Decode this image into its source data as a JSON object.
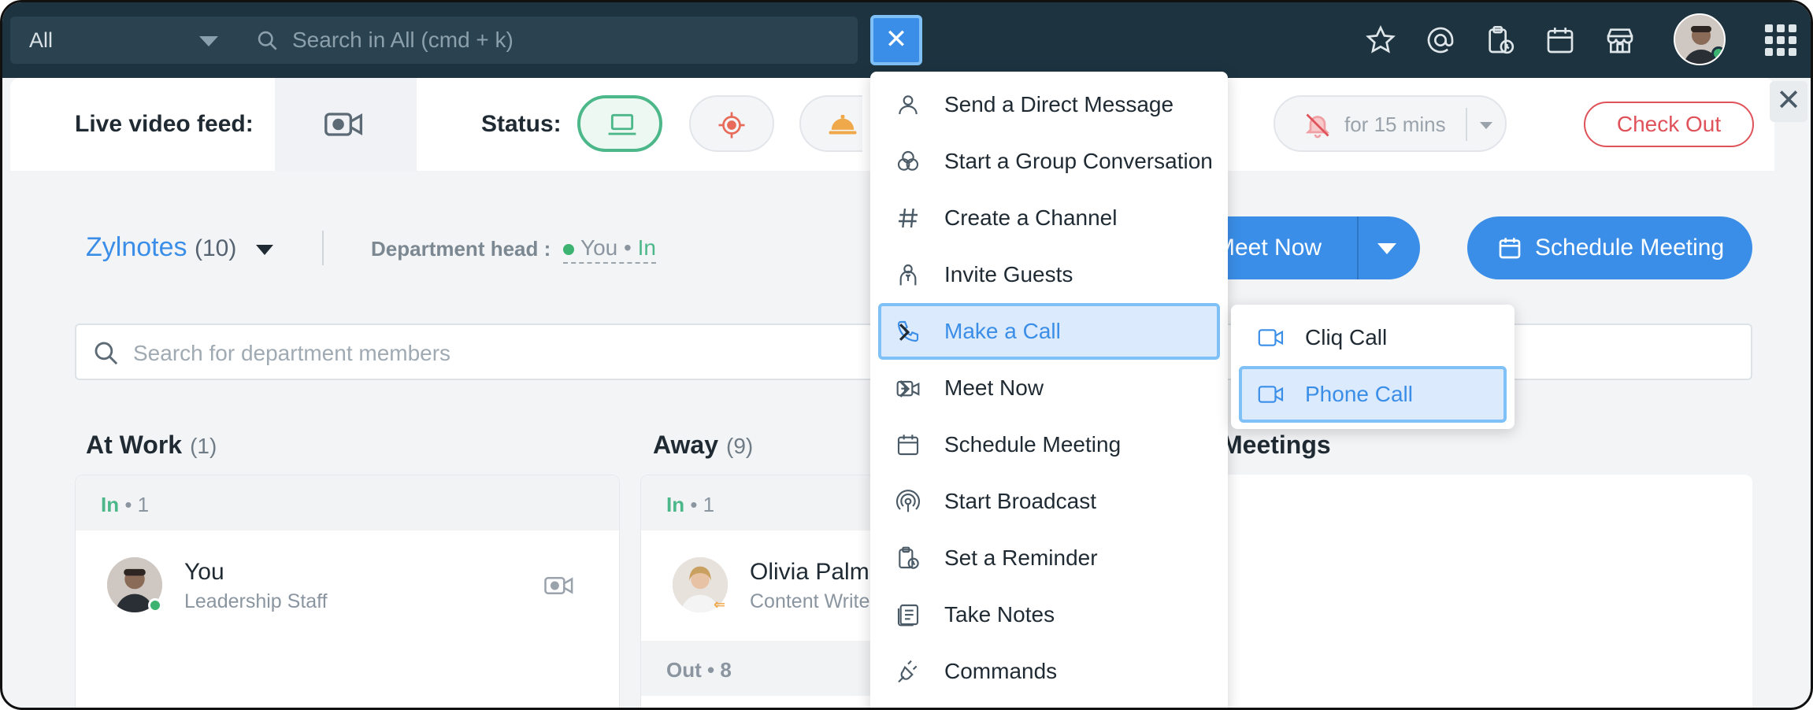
{
  "topbar": {
    "scope_label": "All",
    "search_placeholder": "Search in All (cmd + k)",
    "close_label": "✕"
  },
  "statusbar": {
    "live_video_label": "Live video feed:",
    "status_label": "Status:",
    "dnd_label": "for 15 mins",
    "checkout_label": "Check Out",
    "close_label": "✕"
  },
  "department": {
    "name": "Zylnotes",
    "count": "(10)",
    "head_label": "Department head :",
    "head_value": "You",
    "head_sep": " • ",
    "head_status": "In"
  },
  "actions": {
    "meet_now": "Meet Now",
    "schedule_meeting": "Schedule Meeting"
  },
  "member_search_placeholder": "Search for department members",
  "columns": {
    "at_work": {
      "title": "At Work",
      "count": "(1)",
      "sub_status": "In",
      "sub_count": " • 1",
      "member": {
        "name": "You",
        "role": "Leadership Staff"
      }
    },
    "away": {
      "title": "Away",
      "count": "(9)",
      "sub_status": "In",
      "sub_count": " • 1",
      "member": {
        "name": "Olivia Palme",
        "role": "Content Write"
      },
      "out_label": "Out • 8"
    },
    "meetings": {
      "title": "Meetings"
    }
  },
  "menu": {
    "items": [
      {
        "label": "Send a Direct Message",
        "icon": "person-icon"
      },
      {
        "label": "Start a Group Conversation",
        "icon": "group-icon"
      },
      {
        "label": "Create a Channel",
        "icon": "hash-icon"
      },
      {
        "label": "Invite Guests",
        "icon": "guest-icon"
      },
      {
        "label": "Make a Call",
        "icon": "phone-icon"
      },
      {
        "label": "Meet Now",
        "icon": "video-plus-icon"
      },
      {
        "label": "Schedule Meeting",
        "icon": "calendar-icon"
      },
      {
        "label": "Start Broadcast",
        "icon": "broadcast-icon"
      },
      {
        "label": "Set a Reminder",
        "icon": "reminder-icon"
      },
      {
        "label": "Take Notes",
        "icon": "notes-icon"
      },
      {
        "label": "Commands",
        "icon": "plug-icon"
      }
    ]
  },
  "submenu": {
    "items": [
      {
        "label": "Cliq Call",
        "icon": "video-icon"
      },
      {
        "label": "Phone Call",
        "icon": "video-icon"
      }
    ]
  },
  "colors": {
    "topbar_bg": "#1d3340",
    "accent": "#3a8ee8",
    "in_green": "#4cb88a",
    "checkout_red": "#e0525a"
  }
}
